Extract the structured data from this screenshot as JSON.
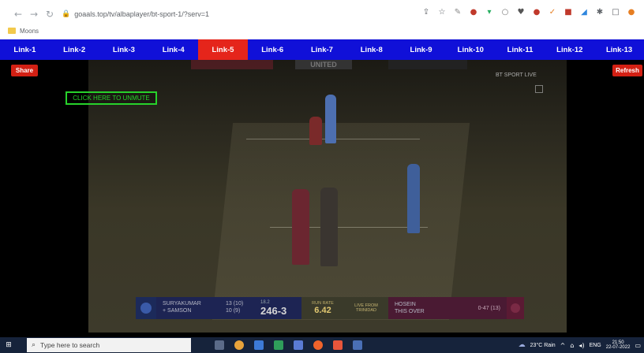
{
  "browser": {
    "url": "goaals.top/tv/albaplayer/bt-sport-1/?serv=1",
    "bookmarks": [
      {
        "label": "Moons"
      }
    ]
  },
  "nav": {
    "links": [
      {
        "label": "Link-1",
        "active": false
      },
      {
        "label": "Link-2",
        "active": false
      },
      {
        "label": "Link-3",
        "active": false
      },
      {
        "label": "Link-4",
        "active": false
      },
      {
        "label": "Link-5",
        "active": true
      },
      {
        "label": "Link-6",
        "active": false
      },
      {
        "label": "Link-7",
        "active": false
      },
      {
        "label": "Link-8",
        "active": false
      },
      {
        "label": "Link-9",
        "active": false
      },
      {
        "label": "Link-10",
        "active": false
      },
      {
        "label": "Link-11",
        "active": false
      },
      {
        "label": "Link-12",
        "active": false
      },
      {
        "label": "Link-13",
        "active": false
      }
    ]
  },
  "actions": {
    "share_label": "Share",
    "refresh_label": "Refresh"
  },
  "player": {
    "unmute_label": "CLICK HERE TO UNMUTE",
    "banner_text": "UNITED",
    "broadcaster": "BT SPORT LIVE"
  },
  "scoreboard": {
    "batter_1": "SURYAKUMAR",
    "batter_2": "+ SAMSON",
    "batter_1_runs": "13 (10)",
    "batter_2_runs": "10 (9)",
    "overs": "18.2",
    "score": "246-3",
    "run_rate_label": "RUN RATE",
    "run_rate": "6.42",
    "live_label": "LIVE FROM",
    "venue": "TRINIDAD",
    "bowler": "HOSEIN",
    "bowler_sub": "THIS OVER",
    "bowler_figures": "0-47 (13)"
  },
  "taskbar": {
    "search_placeholder": "Type here to search",
    "weather": "23°C Rain",
    "language": "ENG",
    "time": "21:50",
    "date": "22-07-2022"
  },
  "colors": {
    "nav_bg": "#1010d8",
    "nav_active": "#e5251b",
    "action_red": "#d32014",
    "unmute_green": "#27d22b",
    "taskbar_bg": "#16233b"
  }
}
